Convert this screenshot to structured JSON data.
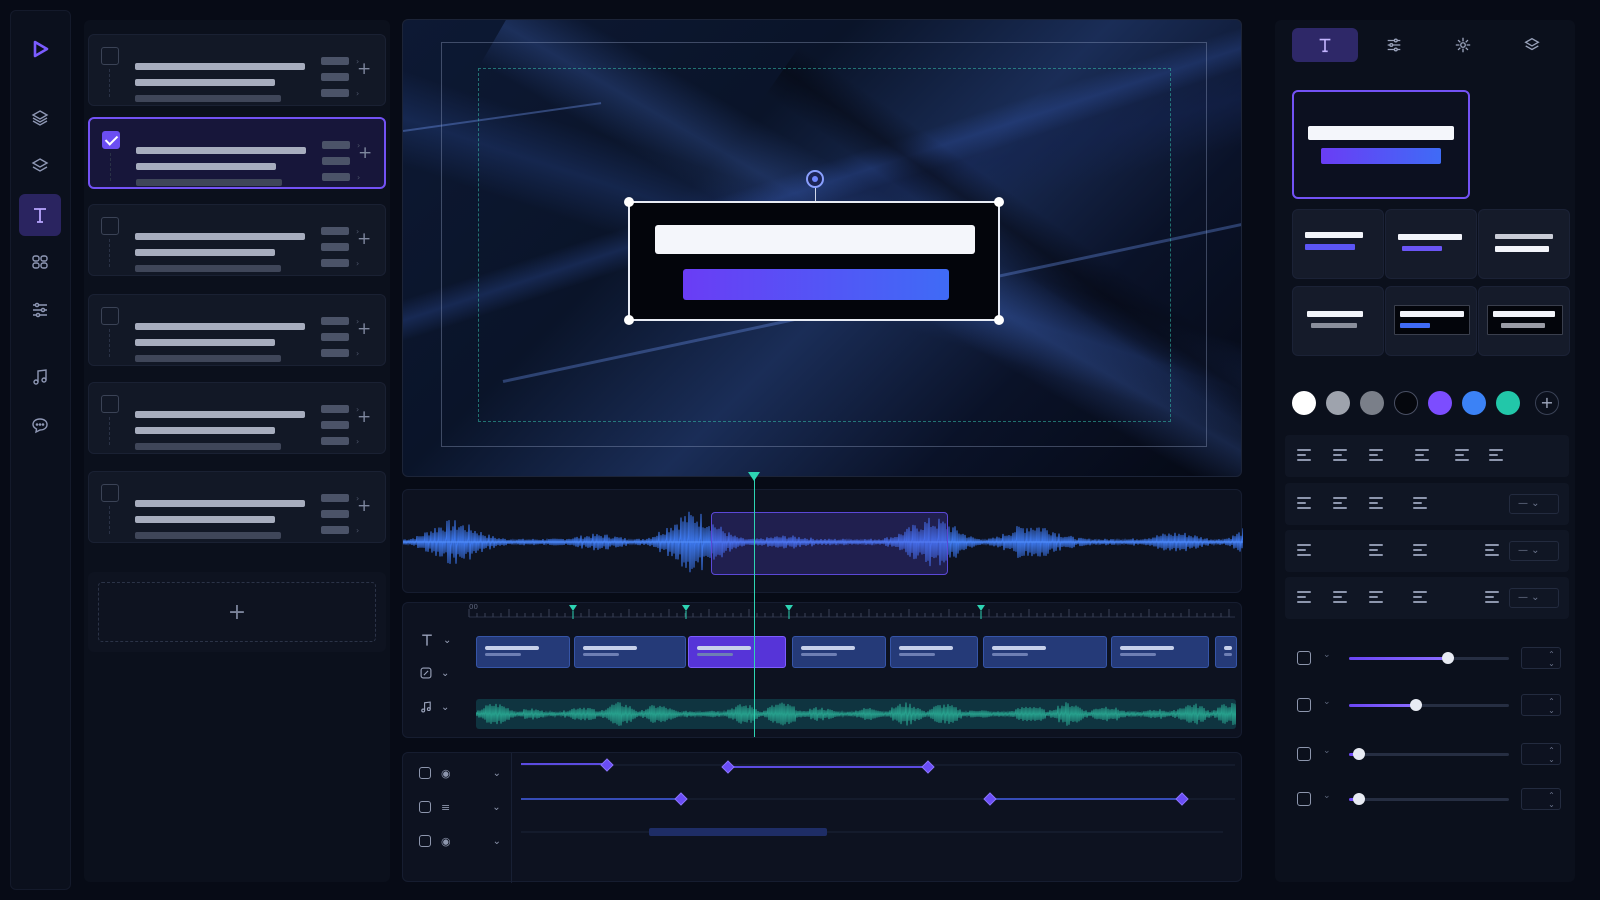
{
  "colors": {
    "accent": "#6b4ef2",
    "accent_blue": "#3f6bf6",
    "teal": "#2dd4b3",
    "bg": "#070b16"
  },
  "nav": {
    "items": [
      {
        "name": "layers-icon"
      },
      {
        "name": "stack-icon"
      },
      {
        "name": "text-icon",
        "active": true
      },
      {
        "name": "elements-icon"
      },
      {
        "name": "adjustments-icon"
      },
      {
        "name": "music-icon"
      },
      {
        "name": "comment-icon"
      }
    ]
  },
  "presets": {
    "items": [
      {
        "selected": false
      },
      {
        "selected": true
      },
      {
        "selected": false
      },
      {
        "selected": false
      },
      {
        "selected": false
      },
      {
        "selected": false
      }
    ],
    "add_label": "+"
  },
  "inspector": {
    "tabs": [
      {
        "name": "text-tab",
        "active": true
      },
      {
        "name": "adjust-tab",
        "active": false
      },
      {
        "name": "effects-tab",
        "active": false
      },
      {
        "name": "layers-tab",
        "active": false
      }
    ],
    "swatches": [
      "#ffffff",
      "#9ea3ad",
      "#7a7f89",
      "#05070d",
      "#7c4dff",
      "#3b82f6",
      "#22c7a9"
    ],
    "swatch_add": "+",
    "selects": [
      "—",
      "—",
      "—"
    ],
    "sliders": [
      {
        "name": "opacity-slider",
        "value": 0.62
      },
      {
        "name": "size-slider",
        "value": 0.42
      },
      {
        "name": "rotation-slider",
        "value": 0.06
      },
      {
        "name": "position-slider",
        "value": 0.06
      }
    ]
  },
  "timeline": {
    "ruler_start": "00",
    "playhead_position": 0.36
  }
}
